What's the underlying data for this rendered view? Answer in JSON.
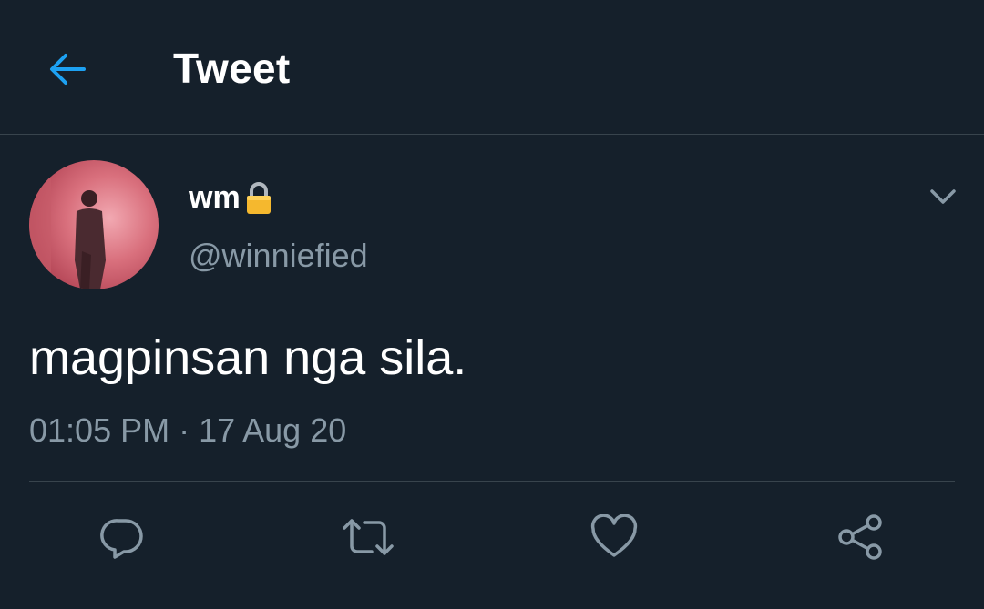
{
  "header": {
    "title": "Tweet",
    "back_icon": "arrow-left-icon"
  },
  "tweet": {
    "author": {
      "display_name": "wm",
      "handle": "@winniefied",
      "protected_icon": "lock-icon"
    },
    "text": "magpinsan nga sila.",
    "time": "01:05 PM",
    "separator": "·",
    "date": "17 Aug 20"
  },
  "actions": [
    {
      "icon": "reply-icon"
    },
    {
      "icon": "retweet-icon"
    },
    {
      "icon": "like-icon"
    },
    {
      "icon": "share-icon"
    }
  ],
  "colors": {
    "background": "#15202b",
    "accent": "#1da1f2",
    "secondary_text": "#8899a6",
    "divider": "#38444d"
  }
}
